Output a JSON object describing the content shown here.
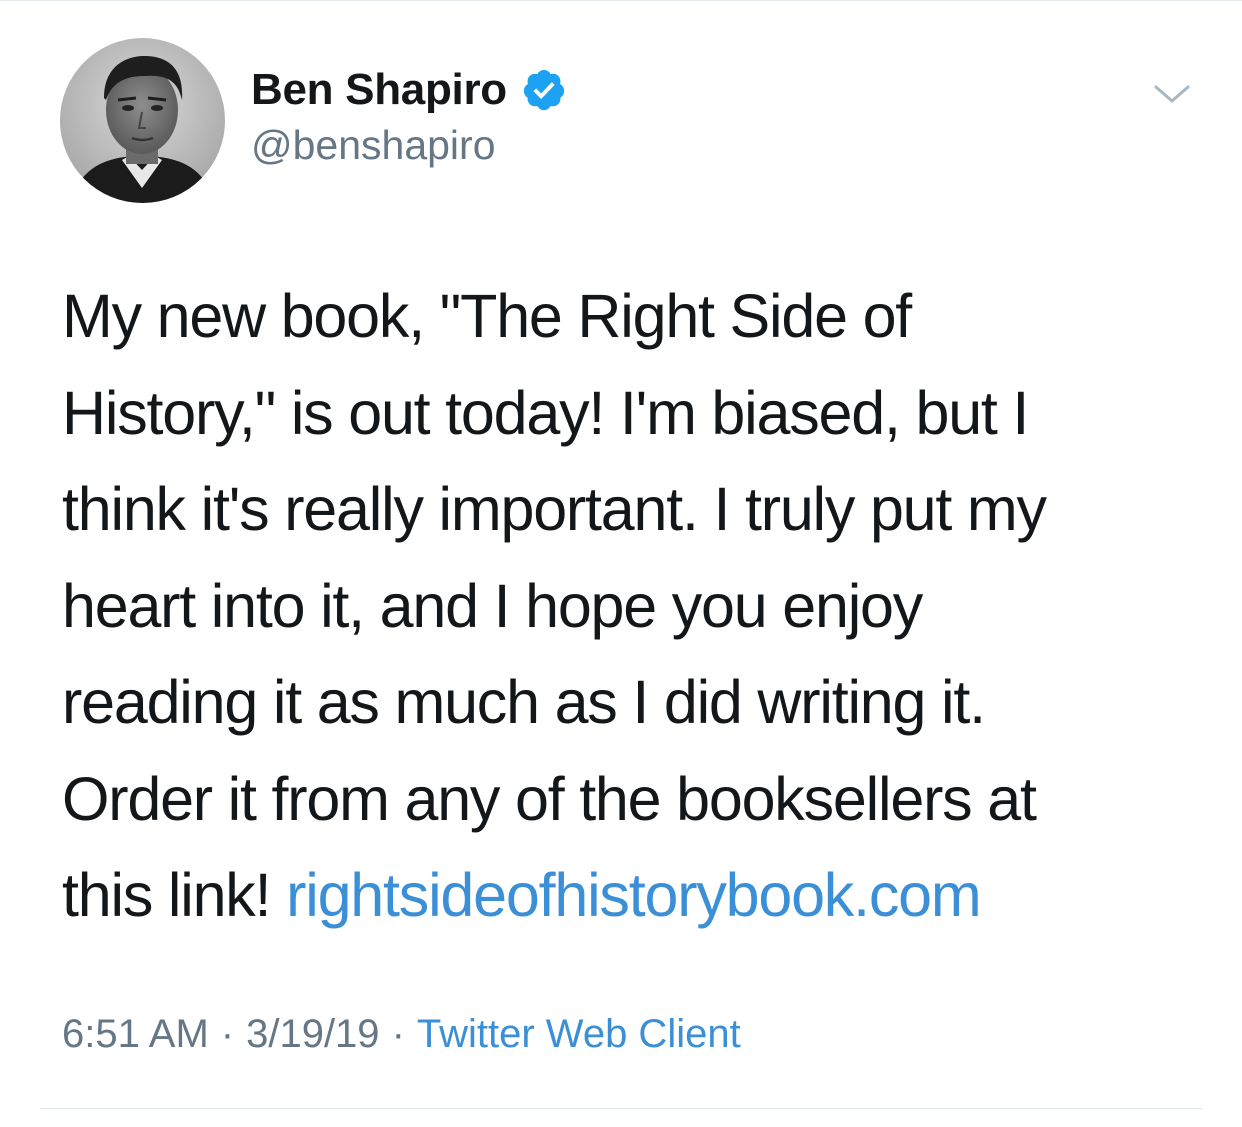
{
  "tweet": {
    "author": {
      "display_name": "Ben Shapiro",
      "handle": "@benshapiro",
      "verified": true,
      "avatar_icon": "profile-photo"
    },
    "text_lines": [
      "My new book, \"The Right Side of",
      "History,\" is out today! I'm biased, but I",
      "think it's really important. I truly put my",
      "heart into it, and I hope you enjoy",
      "reading it as much as I did writing it.",
      "Order it from any of the booksellers at"
    ],
    "last_line_text": "this link! ",
    "link_text": "rightsideofhistorybook.com",
    "time": "6:51 AM",
    "date": "3/19/19",
    "separator": "·",
    "source": "Twitter Web Client"
  },
  "colors": {
    "text": "#14171a",
    "secondary_text": "#657786",
    "link": "#3b8fd6",
    "verified_badge": "#1da1f2",
    "divider": "#e1e8ed",
    "background": "#ffffff"
  },
  "icons": {
    "verified": "verified-badge-icon",
    "menu": "chevron-down-icon"
  }
}
